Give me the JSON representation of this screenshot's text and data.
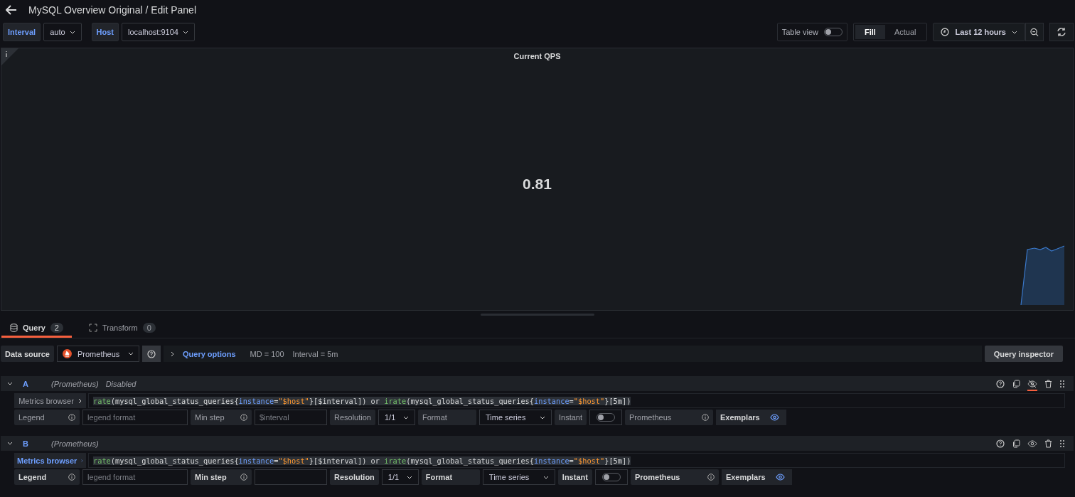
{
  "header": {
    "title": "MySQL Overview Original / Edit Panel"
  },
  "variables": [
    {
      "label": "Interval",
      "value": "auto"
    },
    {
      "label": "Host",
      "value": "localhost:9104"
    }
  ],
  "toolbar": {
    "table_view": {
      "label": "Table view",
      "on": false
    },
    "size_modes": [
      {
        "label": "Fill",
        "selected": true
      },
      {
        "label": "Actual",
        "selected": false
      }
    ],
    "time_range": "Last 12 hours"
  },
  "panel": {
    "title": "Current QPS",
    "value": "0.81"
  },
  "tabs": [
    {
      "label": "Query",
      "count": "2",
      "selected": true
    },
    {
      "label": "Transform",
      "count": "0",
      "selected": false
    }
  ],
  "data_source": {
    "label": "Data source",
    "value": "Prometheus",
    "query_options": "Query options",
    "md": "MD = 100",
    "interval": "Interval = 5m",
    "inspector": "Query inspector"
  },
  "queries": [
    {
      "name": "A",
      "source": "(Prometheus)",
      "status": "Disabled",
      "disabled": true,
      "metrics_browser": "Metrics browser",
      "expr": "rate(mysql_global_status_queries{instance=\"$host\"}[$interval]) or irate(mysql_global_status_queries{instance=\"$host\"}[5m])",
      "legend_label": "Legend",
      "legend_placeholder": "legend format",
      "min_step_label": "Min step",
      "min_step_placeholder": "$interval",
      "resolution_label": "Resolution",
      "resolution": "1/1",
      "format_label": "Format",
      "format": "Time series",
      "instant_label": "Instant",
      "instant": false,
      "type_label": "Prometheus",
      "exemplars": "Exemplars"
    },
    {
      "name": "B",
      "source": "(Prometheus)",
      "disabled": false,
      "metrics_browser": "Metrics browser",
      "expr": "rate(mysql_global_status_queries{instance=\"$host\"}[$interval]) or irate(mysql_global_status_queries{instance=\"$host\"}[5m])",
      "legend_label": "Legend",
      "legend_placeholder": "legend format",
      "min_step_label": "Min step",
      "resolution_label": "Resolution",
      "resolution": "1/1",
      "format_label": "Format",
      "format": "Time series",
      "instant_label": "Instant",
      "instant": false,
      "type_label": "Prometheus",
      "exemplars": "Exemplars"
    }
  ]
}
